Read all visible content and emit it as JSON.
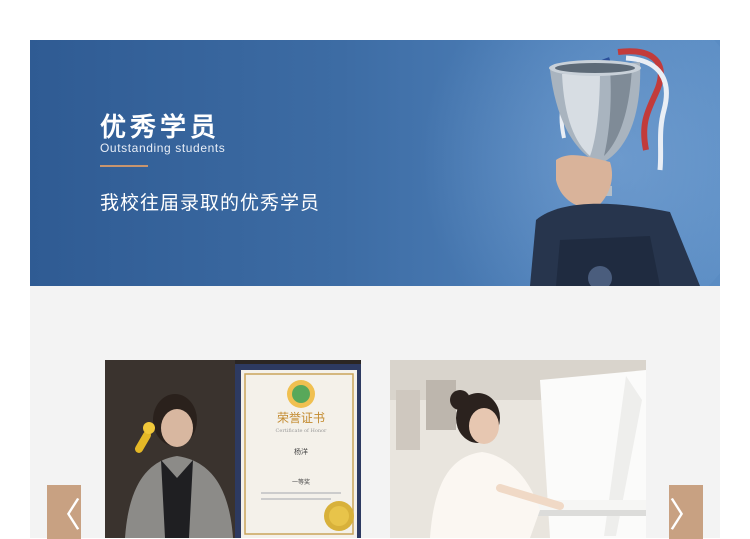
{
  "banner": {
    "title_cn": "优秀学员",
    "title_en": "Outstanding students",
    "subtitle": "我校往届录取的优秀学员",
    "colors": {
      "background": "#3d6ca4",
      "accent_rule": "#c8956e"
    }
  },
  "gallery": {
    "cards": [
      {
        "image": "student-singer-with-certificate-photo",
        "certificate_title": "荣誉证书",
        "certificate_subtitle": "Certificate of Honor",
        "certificate_name": "杨洋",
        "certificate_award": "一等奖"
      },
      {
        "image": "student-pianist-photo"
      }
    ],
    "prev_icon": "chevron-left-icon",
    "next_icon": "chevron-right-icon",
    "prev_glyph": "〈",
    "next_glyph": "〉",
    "colors": {
      "arrow": "#c8a182",
      "panel": "#f3f3f3"
    }
  }
}
